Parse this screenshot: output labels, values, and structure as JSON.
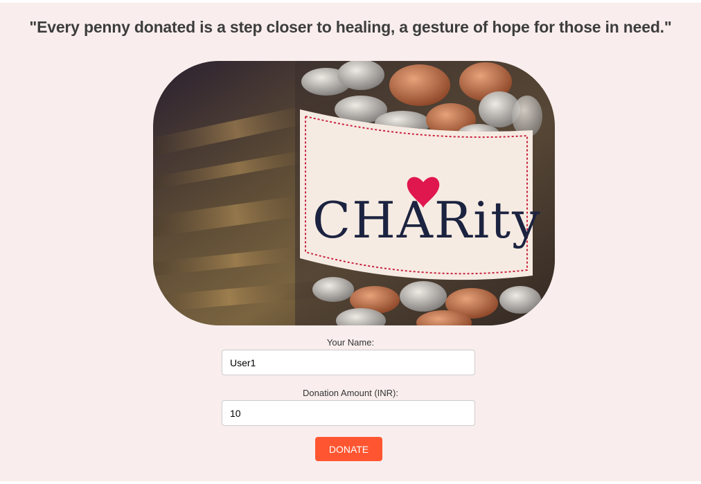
{
  "quote": "\"Every penny donated is a step closer to healing, a gesture of hope for those in need.\"",
  "hero": {
    "icon": "charity-jar-image",
    "jar_label_text": "CHARity"
  },
  "form": {
    "name_label": "Your Name:",
    "name_value": "User1",
    "amount_label": "Donation Amount (INR):",
    "amount_value": "10",
    "donate_label": "DONATE"
  },
  "colors": {
    "background": "#f9eeed",
    "button": "#ff5631",
    "heart": "#e0174f",
    "label_ink": "#1c2340"
  }
}
